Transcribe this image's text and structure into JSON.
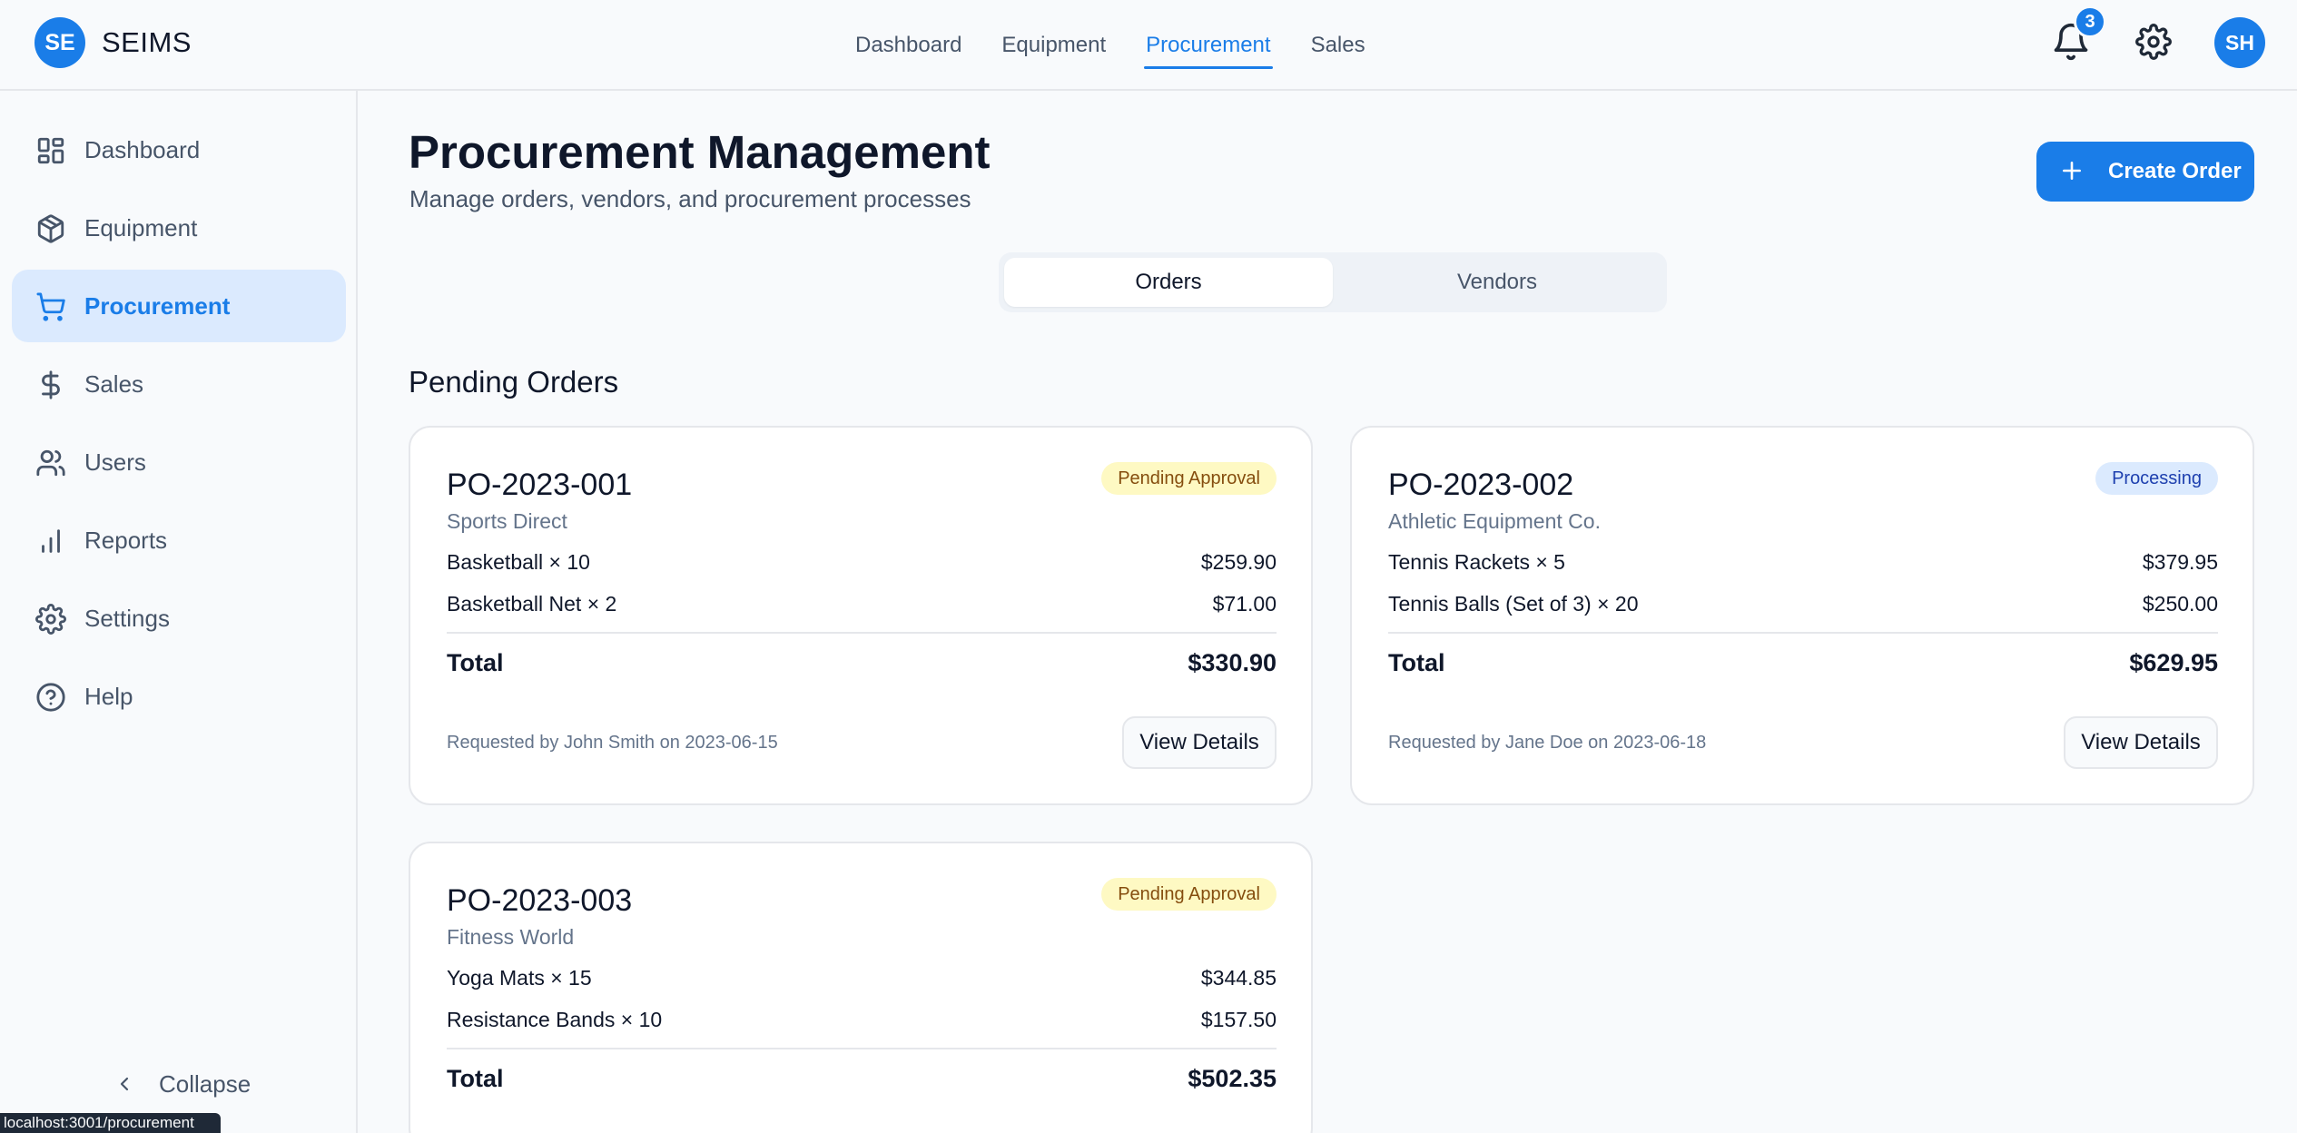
{
  "brand": {
    "logo": "SE",
    "name": "SEIMS"
  },
  "topnav": [
    {
      "label": "Dashboard",
      "active": false
    },
    {
      "label": "Equipment",
      "active": false
    },
    {
      "label": "Procurement",
      "active": true
    },
    {
      "label": "Sales",
      "active": false
    }
  ],
  "header": {
    "notification_count": "3",
    "avatar_initials": "SH"
  },
  "sidebar": {
    "items": [
      {
        "label": "Dashboard",
        "icon": "grid-icon"
      },
      {
        "label": "Equipment",
        "icon": "box-icon"
      },
      {
        "label": "Procurement",
        "icon": "cart-icon",
        "active": true
      },
      {
        "label": "Sales",
        "icon": "dollar-icon"
      },
      {
        "label": "Users",
        "icon": "users-icon"
      },
      {
        "label": "Reports",
        "icon": "bar-chart-icon"
      },
      {
        "label": "Settings",
        "icon": "gear-icon"
      },
      {
        "label": "Help",
        "icon": "help-circle-icon"
      }
    ],
    "collapse_label": "Collapse"
  },
  "page": {
    "title": "Procurement Management",
    "subtitle": "Manage orders, vendors, and procurement processes",
    "create_label": "Create Order",
    "tabs": [
      "Orders",
      "Vendors"
    ],
    "section_title": "Pending Orders"
  },
  "orders": [
    {
      "id": "PO-2023-001",
      "vendor": "Sports Direct",
      "status": "Pending Approval",
      "items": [
        {
          "name": "Basketball × 10",
          "amount": "$259.90"
        },
        {
          "name": "Basketball Net × 2",
          "amount": "$71.00"
        }
      ],
      "total_label": "Total",
      "total": "$330.90",
      "requested": "Requested by John Smith on 2023-06-15",
      "button": "View Details"
    },
    {
      "id": "PO-2023-002",
      "vendor": "Athletic Equipment Co.",
      "status": "Processing",
      "items": [
        {
          "name": "Tennis Rackets × 5",
          "amount": "$379.95"
        },
        {
          "name": "Tennis Balls (Set of 3) × 20",
          "amount": "$250.00"
        }
      ],
      "total_label": "Total",
      "total": "$629.95",
      "requested": "Requested by Jane Doe on 2023-06-18",
      "button": "View Details"
    },
    {
      "id": "PO-2023-003",
      "vendor": "Fitness World",
      "status": "Pending Approval",
      "items": [
        {
          "name": "Yoga Mats × 15",
          "amount": "$344.85"
        },
        {
          "name": "Resistance Bands × 10",
          "amount": "$157.50"
        }
      ],
      "total_label": "Total",
      "total": "$502.35"
    }
  ],
  "status_bar": "localhost:3001/procurement",
  "colors": {
    "accent": "#1a7de8",
    "pending_bg": "#fef9c3",
    "processing_bg": "#dbeafe"
  }
}
